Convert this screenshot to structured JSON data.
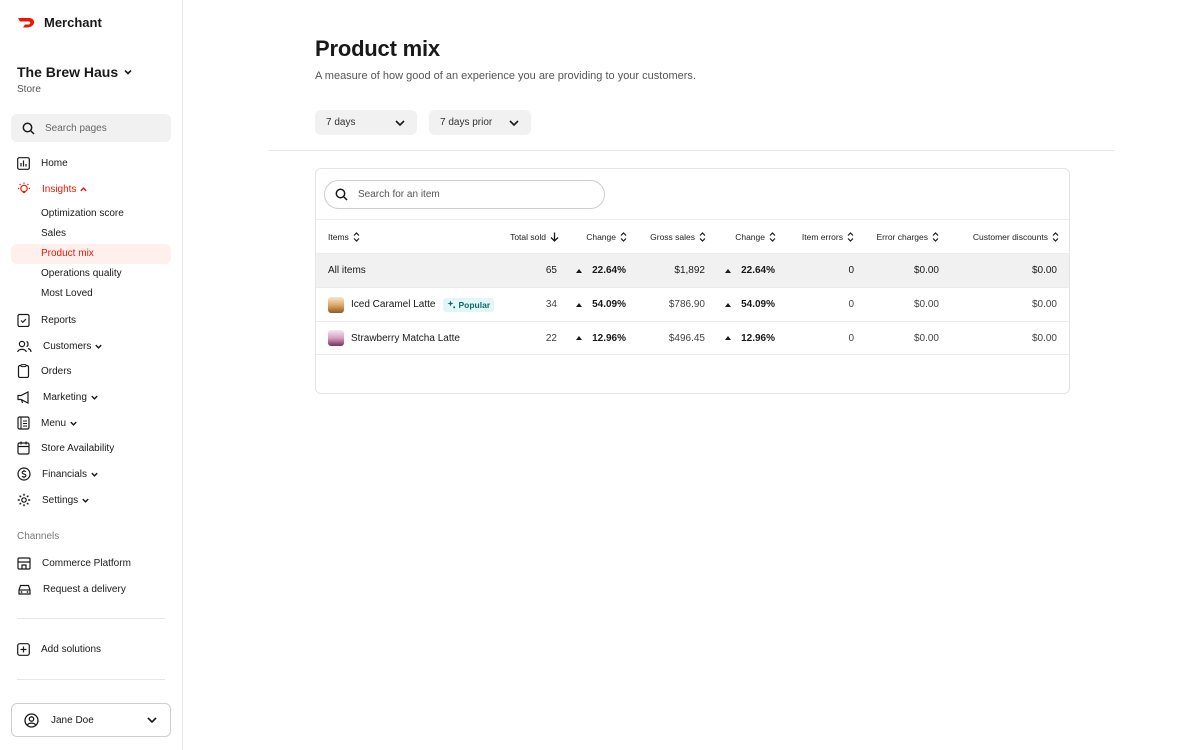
{
  "brand": {
    "name": "Merchant",
    "logo_icon": "doordash-logo-icon",
    "accent": "#eb1700"
  },
  "store": {
    "name": "The Brew Haus",
    "type": "Store"
  },
  "sidebar": {
    "search_placeholder": "Search pages",
    "items": [
      {
        "label": "Home",
        "icon": "bar-chart-icon"
      },
      {
        "label": "Insights",
        "icon": "lightbulb-icon",
        "active": true,
        "expanded": true
      },
      {
        "label": "Reports",
        "icon": "clipboard-icon"
      },
      {
        "label": "Customers",
        "icon": "people-icon"
      },
      {
        "label": "Orders",
        "icon": "clipboard-list-icon"
      },
      {
        "label": "Marketing",
        "icon": "megaphone-icon"
      },
      {
        "label": "Menu",
        "icon": "menu-book-icon"
      },
      {
        "label": "Store Availability",
        "icon": "calendar-icon"
      },
      {
        "label": "Financials",
        "icon": "dollar-circle-icon"
      },
      {
        "label": "Settings",
        "icon": "gear-icon"
      }
    ],
    "insights_sub": [
      "Optimization score",
      "Sales",
      "Product mix",
      "Operations quality",
      "Most Loved"
    ],
    "channels_title": "Channels",
    "channels": [
      {
        "label": "Commerce Platform",
        "icon": "storefront-icon"
      },
      {
        "label": "Request a delivery",
        "icon": "car-icon"
      }
    ],
    "add_solutions": "Add solutions",
    "user": "Jane Doe"
  },
  "page": {
    "title": "Product mix",
    "subtitle": "A measure of how good of an experience you are providing to your customers.",
    "filter_range": "7 days",
    "filter_compare": "7 days prior"
  },
  "table": {
    "search_placeholder": "Search for an item",
    "columns": [
      "Items",
      "Total sold",
      "Change",
      "Gross sales",
      "Change",
      "Item errors",
      "Error charges",
      "Customer discounts"
    ],
    "total_row": {
      "item": "All items",
      "total_sold": "65",
      "change1": "22.64%",
      "gross_sales": "$1,892",
      "change2": "22.64%",
      "item_errors": "0",
      "error_charges": "$0.00",
      "customer_discounts": "$0.00"
    },
    "rows": [
      {
        "item": "Iced Caramel Latte",
        "badge": "Popular",
        "total_sold": "34",
        "change1": "54.09%",
        "gross_sales": "$786.90",
        "change2": "54.09%",
        "item_errors": "0",
        "error_charges": "$0.00",
        "customer_discounts": "$0.00"
      },
      {
        "item": "Strawberry Matcha Latte",
        "total_sold": "22",
        "change1": "12.96%",
        "gross_sales": "$496.45",
        "change2": "12.96%",
        "item_errors": "0",
        "error_charges": "$0.00",
        "customer_discounts": "$0.00"
      }
    ]
  }
}
